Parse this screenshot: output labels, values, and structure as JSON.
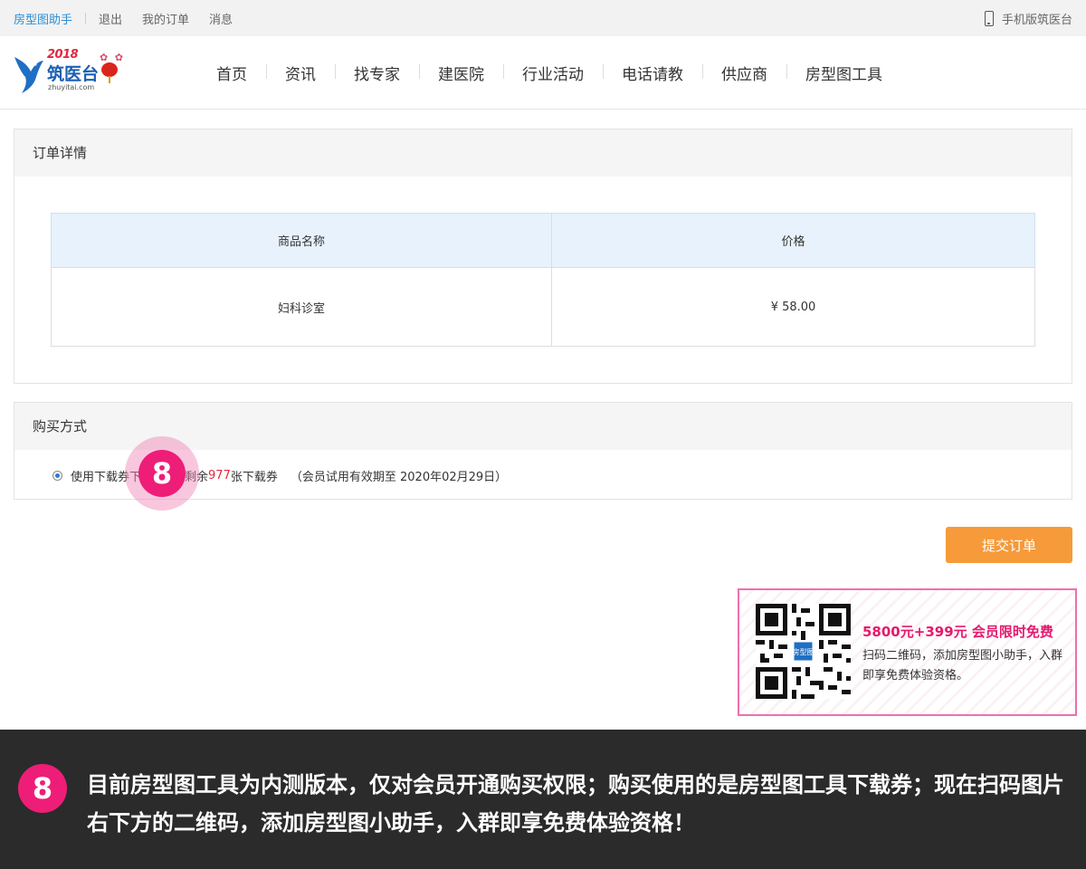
{
  "topbar": {
    "brand": "房型图助手",
    "logout": "退出",
    "my_orders": "我的订单",
    "messages": "消息",
    "mobile": "手机版筑医台"
  },
  "logo": {
    "year": "2018",
    "name": "筑医台",
    "domain": "zhuyitai.com"
  },
  "nav": [
    "首页",
    "资讯",
    "找专家",
    "建医院",
    "行业活动",
    "电话请教",
    "供应商",
    "房型图工具"
  ],
  "order": {
    "title": "订单详情",
    "headers": [
      "商品名称",
      "价格"
    ],
    "rows": [
      {
        "name": "妇科诊室",
        "price": "¥ 58.00"
      }
    ]
  },
  "purchase": {
    "title": "购买方式",
    "option_prefix": "使用下载券下",
    "remaining_prefix": "剩余",
    "remaining_count": "977",
    "remaining_suffix": "张下载券",
    "note": "（会员试用有效期至 2020年02月29日）"
  },
  "badge_number": "8",
  "submit_label": "提交订单",
  "promo": {
    "headline": "5800元+399元 会员限时免费",
    "desc": "扫码二维码，添加房型图小助手，入群即享免费体验资格。",
    "qr_label": "房型图"
  },
  "caption": {
    "number": "8",
    "text": "目前房型图工具为内测版本，仅对会员开通购买权限；购买使用的是房型图工具下载券；现在扫码图片右下方的二维码，添加房型图小助手，入群即享免费体验资格！"
  },
  "colors": {
    "accent_blue": "#2b8fd6",
    "badge_pink": "#ee1d78",
    "submit_orange": "#f69a3a",
    "highlight_red": "#e0283c"
  }
}
